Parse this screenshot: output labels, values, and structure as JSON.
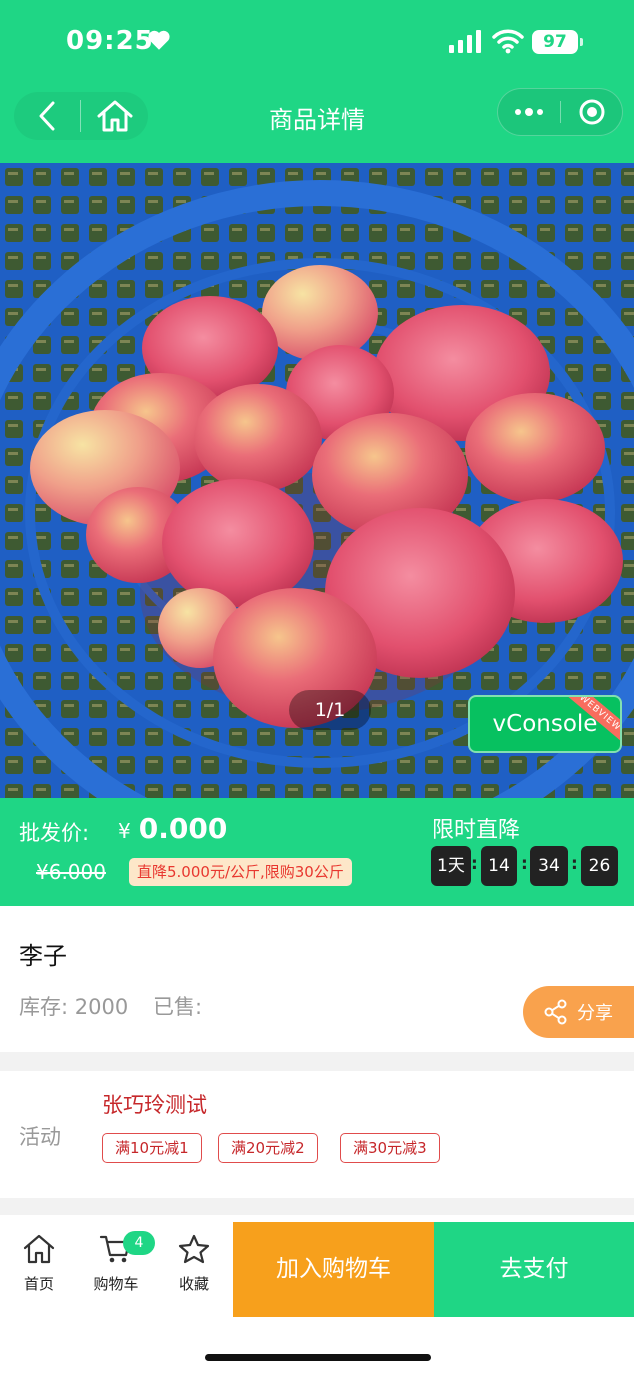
{
  "status_bar": {
    "time": "09:25",
    "battery": "97"
  },
  "nav": {
    "title": "商品详情"
  },
  "gallery": {
    "counter": "1/1"
  },
  "vconsole": {
    "label": "vConsole",
    "ribbon": "WEBVIEW"
  },
  "price": {
    "label": "批发价:",
    "currency": "¥",
    "value": "0.000",
    "original": "¥6.000",
    "promo_tag": "直降5.000元/公斤,限购30公斤",
    "limit_label": "限时直降",
    "countdown": [
      "1天",
      "14",
      "34",
      "26"
    ]
  },
  "product": {
    "name": "李子",
    "stock_text": "库存: 2000",
    "sold_text": "已售:",
    "share_label": "分享"
  },
  "activity": {
    "label": "活动",
    "name": "张巧玲测试",
    "coupons": [
      "满10元减1",
      "满20元减2",
      "满30元减3"
    ]
  },
  "bottom_bar": {
    "tabs": [
      {
        "label": "首页",
        "icon": "home-icon"
      },
      {
        "label": "购物车",
        "icon": "cart-icon",
        "badge": "4"
      },
      {
        "label": "收藏",
        "icon": "star-icon"
      }
    ],
    "add_to_cart": "加入购物车",
    "pay": "去支付"
  },
  "colors": {
    "brand_green": "#1fd685",
    "cart_orange": "#f7a01c",
    "share_orange": "#f9a24d",
    "promo_red": "#c6272a"
  }
}
